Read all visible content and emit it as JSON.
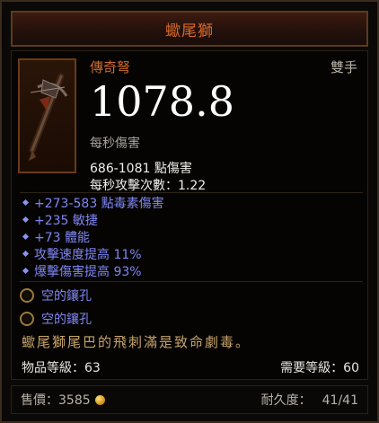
{
  "item": {
    "name": "蠍尾獅",
    "rarity": "傳奇弩",
    "slot": "雙手",
    "dps": "1078.8",
    "dps_label": "每秒傷害",
    "damage_range": "686-1081 點傷害",
    "attacks_per_second": "每秒攻擊次數：1.22",
    "affixes": [
      "+273-583 點毒素傷害",
      "+235 敏捷",
      "+73 體能",
      "攻擊速度提高 11%",
      "爆擊傷害提高 93%"
    ],
    "sockets": [
      "空的鑲孔",
      "空的鑲孔"
    ],
    "flavor_text": "蠍尾獅尾巴的飛刺滿是致命劇毒。",
    "item_level": "物品等級：63",
    "required_level": "需要等級：60",
    "sell_label": "售價：",
    "sell_value": "3585",
    "durability_label": "耐久度：",
    "durability_value": "41/41"
  },
  "colors": {
    "legendary_orange": "#d96a2c",
    "magic_blue": "#7f86f2",
    "flavor_gold": "#c8a46a"
  },
  "icons": {
    "item_image": "crossbow-icon",
    "affix_bullet": "diamond-icon",
    "socket": "empty-socket-icon",
    "currency": "gold-coin-icon"
  }
}
